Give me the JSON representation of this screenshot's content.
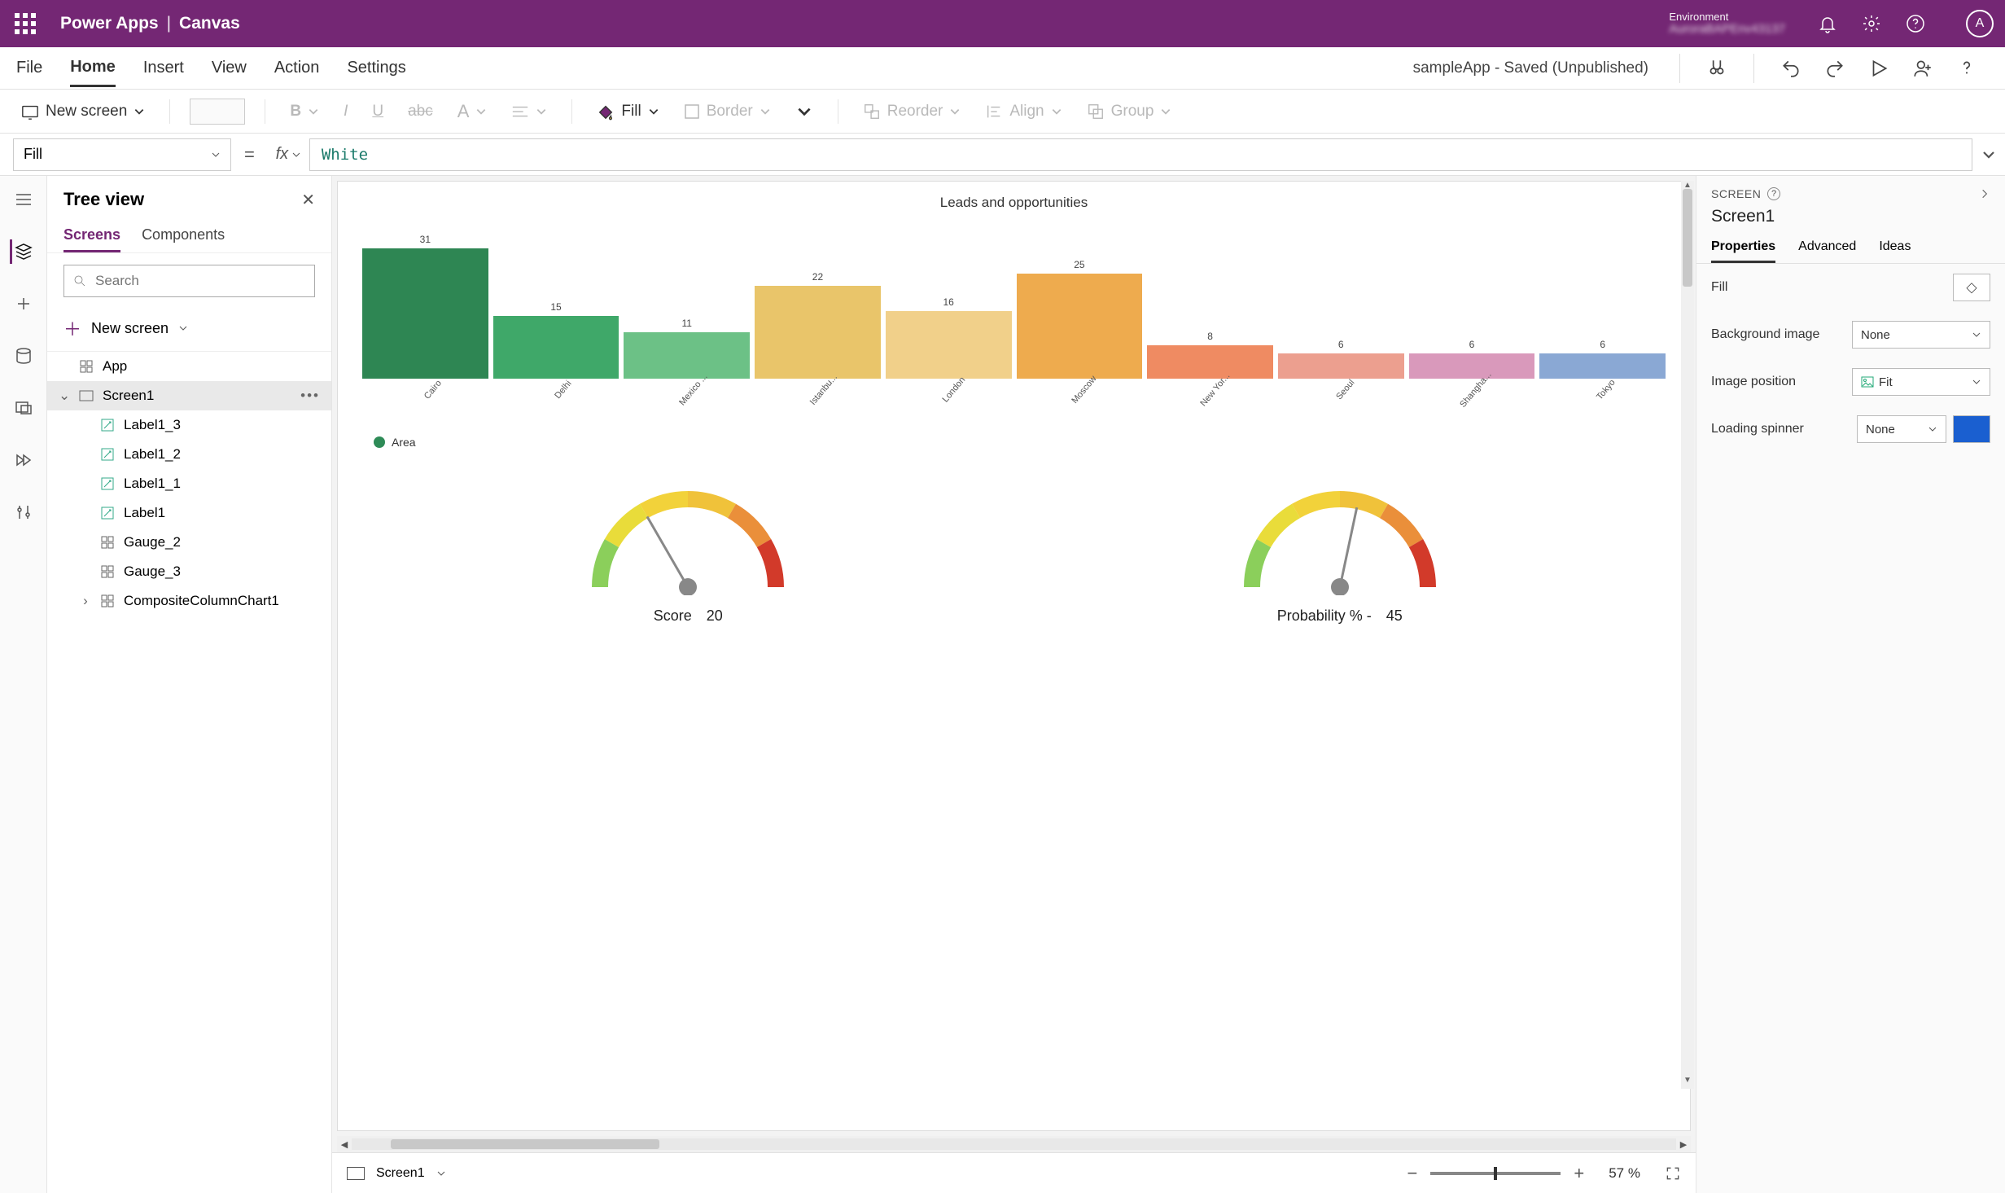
{
  "topbar": {
    "brand_left": "Power Apps",
    "brand_right": "Canvas",
    "env_label": "Environment",
    "env_value": "AuroraBAPEnv43137",
    "avatar_initial": "A"
  },
  "ribbon": {
    "tabs": [
      "File",
      "Home",
      "Insert",
      "View",
      "Action",
      "Settings"
    ],
    "active_tab": "Home",
    "status": "sampleApp - Saved (Unpublished)"
  },
  "toolbar": {
    "new_screen": "New screen",
    "fill": "Fill",
    "border": "Border",
    "reorder": "Reorder",
    "align": "Align",
    "group": "Group"
  },
  "formula": {
    "property": "Fill",
    "value": "White"
  },
  "tree": {
    "title": "Tree view",
    "tabs": [
      "Screens",
      "Components"
    ],
    "active_tab": "Screens",
    "search_placeholder": "Search",
    "new_screen": "New screen",
    "app_label": "App",
    "selected": "Screen1",
    "screen1": "Screen1",
    "items": [
      "Label1_3",
      "Label1_2",
      "Label1_1",
      "Label1",
      "Gauge_2",
      "Gauge_3",
      "CompositeColumnChart1"
    ]
  },
  "props": {
    "category": "SCREEN",
    "name": "Screen1",
    "tabs": [
      "Properties",
      "Advanced",
      "Ideas"
    ],
    "active_tab": "Properties",
    "rows": {
      "fill": "Fill",
      "bgimage": "Background image",
      "bgimage_val": "None",
      "imgpos": "Image position",
      "imgpos_val": "Fit",
      "spinner": "Loading spinner",
      "spinner_val": "None"
    }
  },
  "stagebar": {
    "screen": "Screen1",
    "zoom": "57",
    "zoom_unit": "%"
  },
  "chart_data": {
    "type": "bar",
    "title": "Leads and opportunities",
    "legend": "Area",
    "categories": [
      "Cairo",
      "Delhi",
      "Mexico ...",
      "Istanbu...",
      "London",
      "Moscow",
      "New Yor...",
      "Seoul",
      "Shangha...",
      "Tokyo"
    ],
    "values": [
      31,
      15,
      11,
      22,
      16,
      25,
      8,
      6,
      6,
      6
    ],
    "colors": [
      "#2e8653",
      "#3fa869",
      "#6cc186",
      "#e9c56a",
      "#f1d08a",
      "#eeab4e",
      "#ef8b62",
      "#ec9f8f",
      "#d999bb",
      "#8aa8d4"
    ],
    "ylim": [
      0,
      31
    ]
  },
  "gauges": [
    {
      "label": "Score",
      "value": 20,
      "needle_deg": -120
    },
    {
      "label": "Probability % -",
      "value": 45,
      "needle_deg": -78
    }
  ]
}
